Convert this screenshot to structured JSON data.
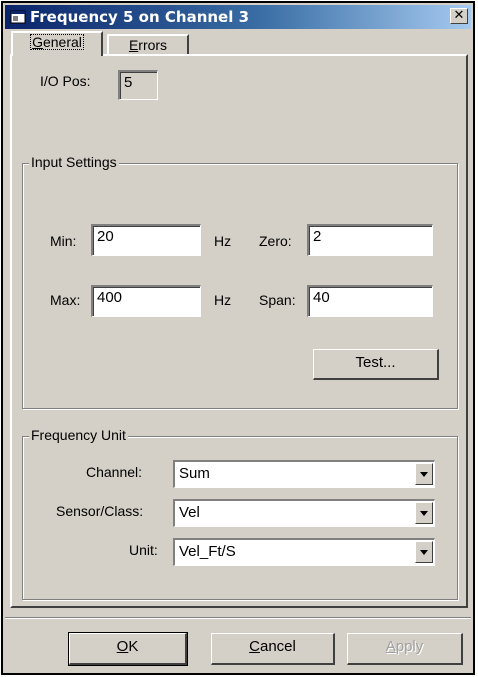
{
  "window": {
    "title": "Frequency 5 on Channel 3",
    "close_glyph": "✕"
  },
  "tabs": [
    {
      "label_prefix": "",
      "mnemonic": "G",
      "label_rest": "eneral",
      "active": true
    },
    {
      "label_prefix": "",
      "mnemonic": "E",
      "label_rest": "rrors",
      "active": false
    }
  ],
  "io_pos": {
    "label": "I/O Pos:",
    "value": "5"
  },
  "input_settings": {
    "title": "Input Settings",
    "min_label": "Min:",
    "min_value": "20",
    "min_unit": "Hz",
    "max_label": "Max:",
    "max_value": "400",
    "max_unit": "Hz",
    "zero_label": "Zero:",
    "zero_value": "2",
    "span_label": "Span:",
    "span_value": "40",
    "test_label": "Test..."
  },
  "frequency_unit": {
    "title": "Frequency Unit",
    "channel_label": "Channel:",
    "channel_value": "Sum",
    "sensor_label": "Sensor/Class:",
    "sensor_value": "Vel",
    "unit_label": "Unit:",
    "unit_value": "Vel_Ft/S"
  },
  "buttons": {
    "ok_mnemonic": "O",
    "ok_rest": "K",
    "cancel_mnemonic": "C",
    "cancel_rest": "ancel",
    "apply_mnemonic": "A",
    "apply_rest": "pply"
  },
  "icons": {
    "title_icon": "app-window-icon",
    "close": "close-icon",
    "dropdown": "chevron-down-icon"
  },
  "colors": {
    "titlebar_start": "#0a246a",
    "titlebar_end": "#a6caf0",
    "face": "#d4d0c8"
  }
}
